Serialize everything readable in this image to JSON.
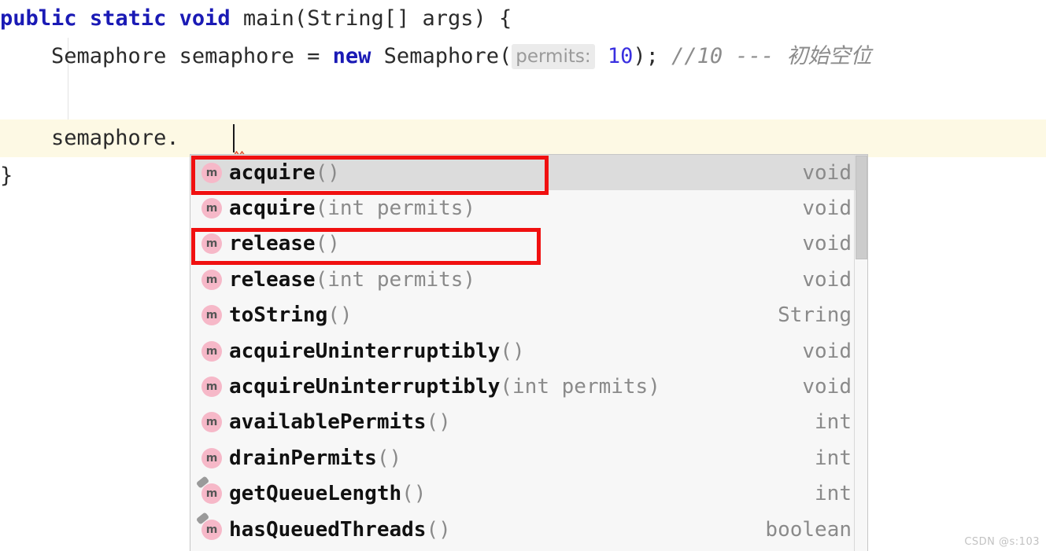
{
  "editor": {
    "lines": [
      {
        "id": "line-1",
        "tokens": [
          {
            "t": "public",
            "k": "kw"
          },
          {
            "t": " ",
            "k": "plain"
          },
          {
            "t": "static",
            "k": "kw"
          },
          {
            "t": " ",
            "k": "plain"
          },
          {
            "t": "void",
            "k": "kw"
          },
          {
            "t": " main(String[] args) {",
            "k": "plain"
          }
        ]
      },
      {
        "id": "line-2",
        "tokens": [
          {
            "t": "    Semaphore semaphore = ",
            "k": "plain"
          },
          {
            "t": "new",
            "k": "kw"
          },
          {
            "t": " Semaphore(",
            "k": "plain"
          },
          {
            "t": "permits:",
            "k": "hint"
          },
          {
            "t": " ",
            "k": "plain"
          },
          {
            "t": "10",
            "k": "num"
          },
          {
            "t": "); ",
            "k": "plain"
          },
          {
            "t": "//10 --- ",
            "k": "comment"
          },
          {
            "t": "初始空位",
            "k": "cjk"
          }
        ]
      },
      {
        "id": "line-3",
        "tokens": []
      },
      {
        "id": "line-4",
        "tokens": [
          {
            "t": "    semaphore.",
            "k": "plain"
          }
        ]
      },
      {
        "id": "line-5",
        "tokens": [
          {
            "t": "}",
            "k": "plain"
          }
        ]
      }
    ]
  },
  "completion": {
    "items": [
      {
        "icon": "method-icon",
        "name": "acquire",
        "params": "()",
        "type": "void",
        "selected": true,
        "inherited": false
      },
      {
        "icon": "method-icon",
        "name": "acquire",
        "params": "(int permits)",
        "type": "void",
        "selected": false,
        "inherited": false
      },
      {
        "icon": "method-icon",
        "name": "release",
        "params": "()",
        "type": "void",
        "selected": false,
        "inherited": false
      },
      {
        "icon": "method-icon",
        "name": "release",
        "params": "(int permits)",
        "type": "void",
        "selected": false,
        "inherited": false
      },
      {
        "icon": "method-icon",
        "name": "toString",
        "params": "()",
        "type": "String",
        "selected": false,
        "inherited": false
      },
      {
        "icon": "method-icon",
        "name": "acquireUninterruptibly",
        "params": "()",
        "type": "void",
        "selected": false,
        "inherited": false
      },
      {
        "icon": "method-icon",
        "name": "acquireUninterruptibly",
        "params": "(int permits)",
        "type": "void",
        "selected": false,
        "inherited": false
      },
      {
        "icon": "method-icon",
        "name": "availablePermits",
        "params": "()",
        "type": "int",
        "selected": false,
        "inherited": false
      },
      {
        "icon": "method-icon",
        "name": "drainPermits",
        "params": "()",
        "type": "int",
        "selected": false,
        "inherited": false
      },
      {
        "icon": "method-inherited-icon",
        "name": "getQueueLength",
        "params": "()",
        "type": "int",
        "selected": false,
        "inherited": true
      },
      {
        "icon": "method-inherited-icon",
        "name": "hasQueuedThreads",
        "params": "()",
        "type": "boolean",
        "selected": false,
        "inherited": true
      }
    ],
    "icon_letter": "m"
  },
  "annotations": [
    {
      "id": "highlight-acquire",
      "label": "acquire()"
    },
    {
      "id": "highlight-release",
      "label": "release()"
    }
  ],
  "watermark": {
    "text": "CSDN @s:103"
  },
  "colors": {
    "keyword": "#1a1ab5",
    "number": "#3a30e0",
    "comment": "#8c8c8c",
    "selection": "#dcdcdc",
    "current_line": "#fdf9e4",
    "annotation_red": "#f01010",
    "method_icon": "#f6b8c8"
  }
}
